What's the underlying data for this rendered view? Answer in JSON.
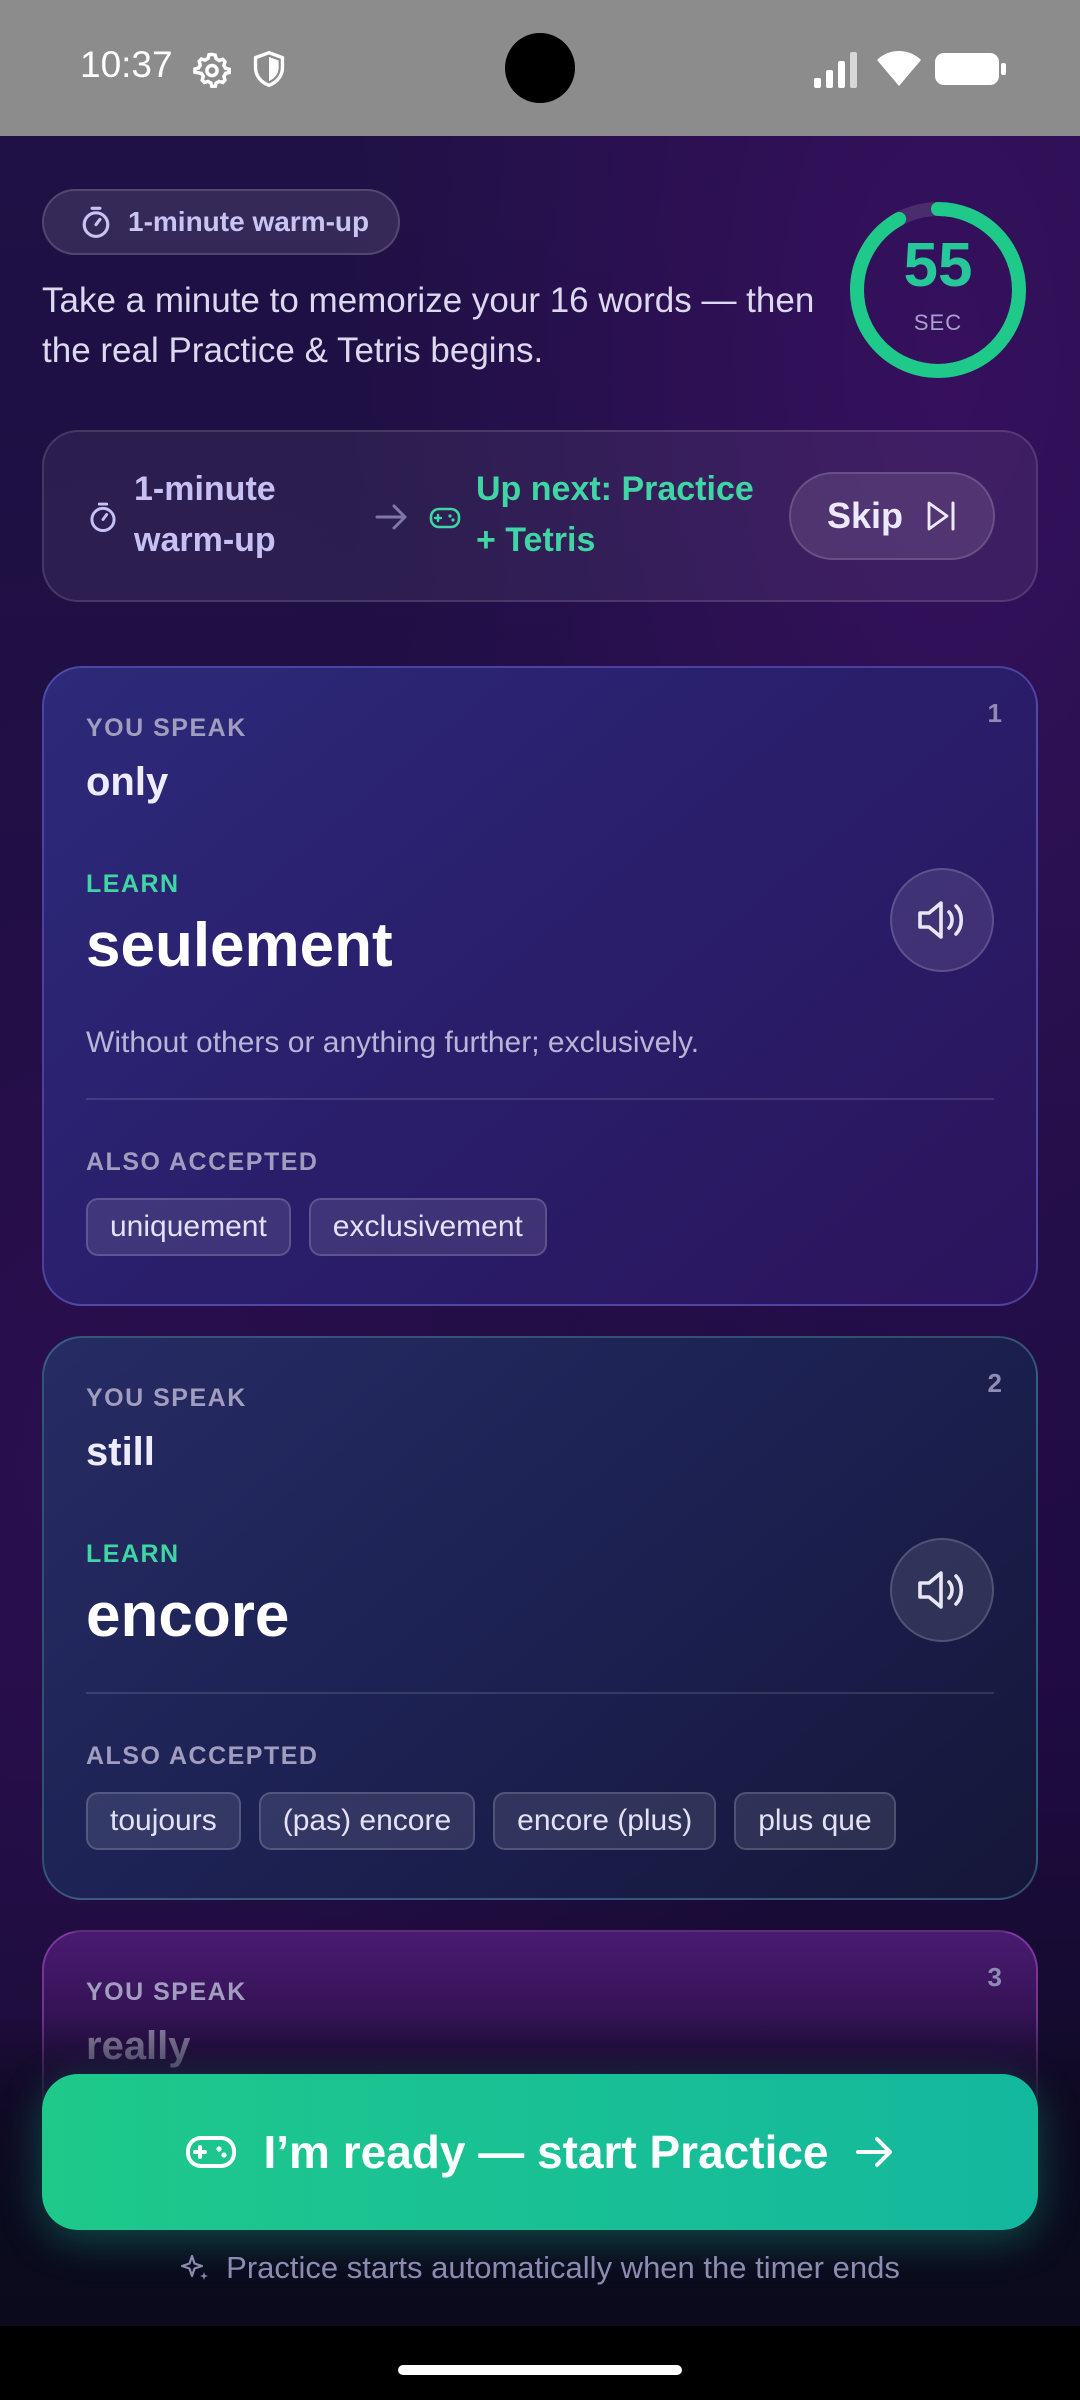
{
  "status_bar": {
    "time": "10:37",
    "icons": [
      "gear-icon",
      "shield-icon",
      "signal-icon",
      "wifi-icon",
      "battery-icon"
    ]
  },
  "header": {
    "pill_label": "1-minute warm-up",
    "intro": "Take a minute to memorize your 16 words — then the real Practice & Tetris begins.",
    "timer": {
      "value": "55",
      "unit": "SEC",
      "remaining_fraction": 0.92
    }
  },
  "flow": {
    "step_current": "1-minute warm-up",
    "step_next": "Up next: Practice + Tetris",
    "skip_label": "Skip"
  },
  "colors": {
    "accent_green": "#1ec98a",
    "teal": "#14b89e",
    "background": "#1f1145"
  },
  "cards": [
    {
      "number": "1",
      "speak_label": "YOU SPEAK",
      "speak_word": "only",
      "learn_label": "LEARN",
      "learn_word": "seulement",
      "definition": "Without others or anything further; exclusively.",
      "also_label": "ALSO ACCEPTED",
      "also": [
        "uniquement",
        "exclusivement"
      ]
    },
    {
      "number": "2",
      "speak_label": "YOU SPEAK",
      "speak_word": "still",
      "learn_label": "LEARN",
      "learn_word": "encore",
      "also_label": "ALSO ACCEPTED",
      "also": [
        "toujours",
        "(pas) encore",
        "encore (plus)",
        "plus que"
      ]
    },
    {
      "number": "3",
      "speak_label": "YOU SPEAK",
      "speak_word": "really"
    }
  ],
  "cta": {
    "label": "I’m ready — start Practice",
    "hint": "Practice starts automatically when the timer ends"
  }
}
